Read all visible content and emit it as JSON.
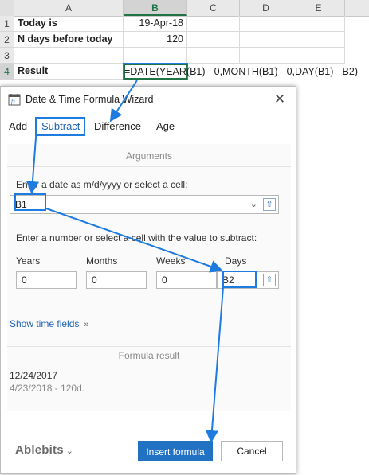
{
  "sheet": {
    "columns": [
      "A",
      "B",
      "C",
      "D",
      "E"
    ],
    "rows": [
      "1",
      "2",
      "3",
      "4"
    ],
    "cells": {
      "a1": "Today is",
      "b1": "19-Apr-18",
      "a2": "N days before today",
      "b2": "120",
      "a4": "Result",
      "b4_formula": "=DATE(YEAR(B1) - 0,MONTH(B1) - 0,DAY(B1) - B2)"
    }
  },
  "dialog": {
    "title": "Date & Time Formula Wizard",
    "close_glyph": "✕",
    "tabs": [
      {
        "label": "Add"
      },
      {
        "label": "Subtract"
      },
      {
        "label": "Difference"
      },
      {
        "label": "Age"
      }
    ],
    "active_tab": "Subtract",
    "arguments_heading": "Arguments",
    "date_label": "Enter a date as m/d/yyyy or select a cell:",
    "date_value": "B1",
    "number_label": "Enter a number or select a cell with the value to subtract:",
    "fields": {
      "years": {
        "label": "Years",
        "value": "0"
      },
      "months": {
        "label": "Months",
        "value": "0"
      },
      "weeks": {
        "label": "Weeks",
        "value": "0"
      },
      "days": {
        "label": "Days",
        "value": "B2"
      }
    },
    "show_time_fields": "Show time fields",
    "formula_result_heading": "Formula result",
    "result_value": "12/24/2017",
    "result_detail": "4/23/2018 - 120d.",
    "brand": "Ablebits",
    "insert_button": "Insert formula",
    "cancel_button": "Cancel"
  },
  "colors": {
    "accent": "#1e7be0",
    "excel_green": "#217346",
    "primary_button": "#2272c3"
  }
}
